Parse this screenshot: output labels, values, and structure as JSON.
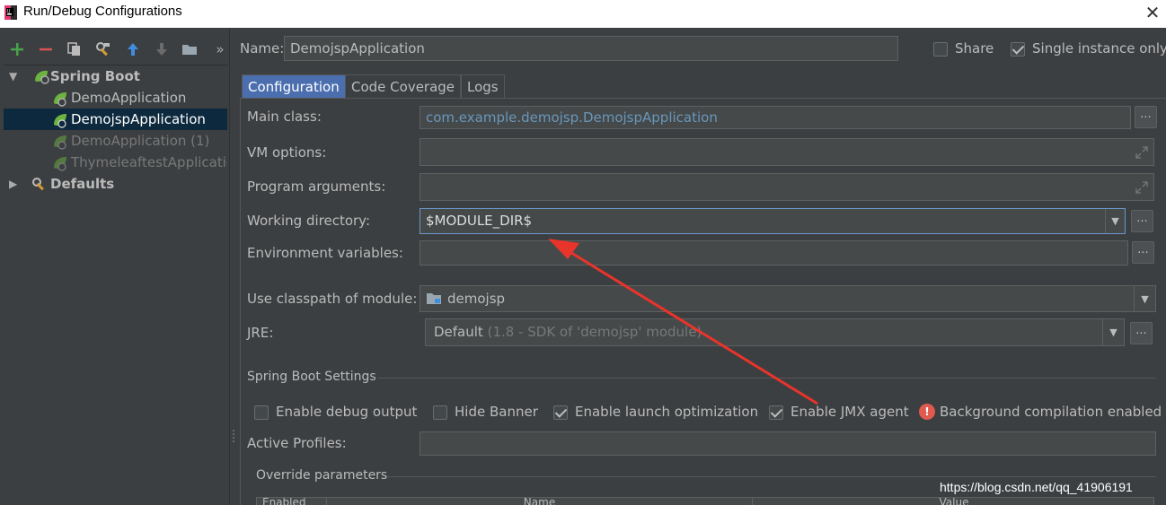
{
  "window": {
    "title": "Run/Debug Configurations",
    "close_glyph": "✕"
  },
  "toolbar": {
    "icons": [
      "add-icon",
      "remove-icon",
      "copy-icon",
      "settings-wrench-icon",
      "move-up-icon",
      "move-down-icon",
      "folder-icon",
      "more-chevron-icon"
    ],
    "more_glyph": "»"
  },
  "tree": {
    "spring_boot": "Spring Boot",
    "items": [
      {
        "label": "DemoApplication"
      },
      {
        "label": "DemojspApplication"
      },
      {
        "label": "DemoApplication (1)"
      },
      {
        "label": "ThymeleaftestApplicatic"
      }
    ],
    "defaults": "Defaults"
  },
  "header": {
    "name_label": "Name:",
    "name_value": "DemojspApplication",
    "share_label": "Share",
    "single_instance_label": "Single instance only",
    "share_checked": false,
    "single_instance_checked": true
  },
  "tabs": [
    "Configuration",
    "Code Coverage",
    "Logs"
  ],
  "form": {
    "main_class_label": "Main class:",
    "main_class_value": "com.example.demojsp.DemojspApplication",
    "vm_options_label": "VM options:",
    "program_args_label": "Program arguments:",
    "working_dir_label": "Working directory:",
    "working_dir_value": "$MODULE_DIR$",
    "env_vars_label": "Environment variables:",
    "classpath_label": "Use classpath of module:",
    "classpath_value": "demojsp",
    "jre_label": "JRE:",
    "jre_value": "Default",
    "jre_hint": "(1.8 - SDK of 'demojsp' module)",
    "dots": "...",
    "dropdown_glyph": "▼"
  },
  "spring_boot_settings": {
    "title": "Spring Boot Settings",
    "checkboxes": [
      {
        "label": "Enable debug output",
        "checked": false
      },
      {
        "label": "Hide Banner",
        "checked": false
      },
      {
        "label": "Enable launch optimization",
        "checked": true
      },
      {
        "label": "Enable JMX agent",
        "checked": true
      }
    ],
    "warning_text": "Background compilation enabled",
    "warning_glyph": "!",
    "active_profiles_label": "Active Profiles:",
    "override_title": "Override parameters",
    "table_headers": [
      "Enabled",
      "Name",
      "Value"
    ]
  },
  "colors": {
    "background": "#3c3f41",
    "field": "#45494a",
    "selection": "#0d293e",
    "active_tab": "#4b6eaf",
    "annotation_arrow": "#e8342a",
    "link_text": "#6897bb"
  },
  "watermark": "https://blog.csdn.net/qq_41906191"
}
